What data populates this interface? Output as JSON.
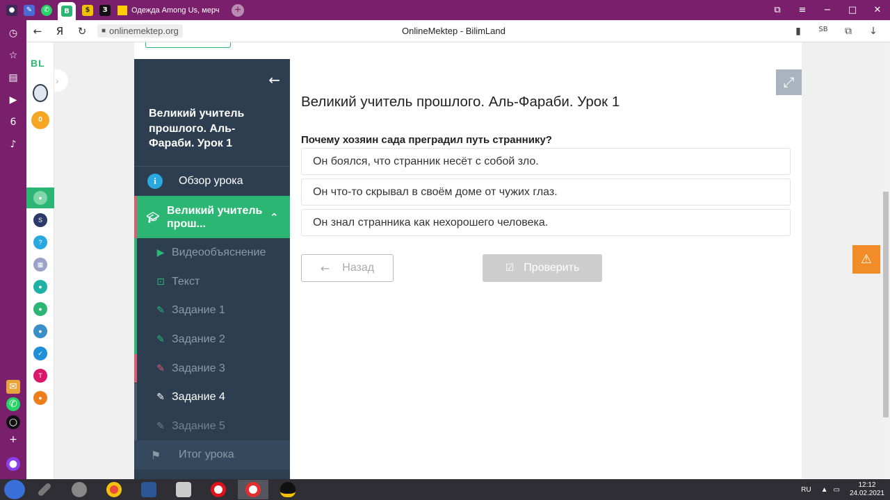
{
  "browser": {
    "tab_title": "Одежда Among Us, мерч",
    "url": "onlinemektep.org",
    "page_title": "OnlineMektep - BilimLand"
  },
  "site_rail": {
    "logo": "BL",
    "coins": "0"
  },
  "lesson_nav": {
    "title": "Великий учитель прошлого. Аль-Фараби. Урок 1",
    "overview": "Обзор урока",
    "section": "Великий учитель прош...",
    "items": [
      {
        "label": "Видеообъяснение",
        "icon": "play-icon",
        "state": "done"
      },
      {
        "label": "Текст",
        "icon": "book-icon",
        "state": "done"
      },
      {
        "label": "Задание 1",
        "icon": "edit-icon",
        "state": "done"
      },
      {
        "label": "Задание 2",
        "icon": "edit-icon",
        "state": "done"
      },
      {
        "label": "Задание 3",
        "icon": "edit-icon",
        "state": "wrong"
      },
      {
        "label": "Задание 4",
        "icon": "edit-icon",
        "state": "current"
      },
      {
        "label": "Задание 5",
        "icon": "edit-icon",
        "state": "pending"
      }
    ],
    "summary": "Итог урока"
  },
  "main": {
    "heading": "Великий учитель прошлого. Аль-Фараби. Урок 1",
    "question": "Почему хозяин сада преградил путь страннику?",
    "options": [
      "Он боялся, что странник несёт с собой зло.",
      "Он что-то скрывал в своём доме от чужих глаз.",
      "Он знал странника как нехорошего человека."
    ],
    "back_label": "Назад",
    "check_label": "Проверить"
  },
  "taskbar": {
    "language": "RU",
    "time": "12:12",
    "date": "24.02.2021"
  },
  "colors": {
    "accent_green": "#2bb673",
    "nav_dark": "#2c3e50",
    "error_red": "#e05a6d",
    "warning_orange": "#f28c28",
    "browser_purple": "#7a1f6b"
  }
}
